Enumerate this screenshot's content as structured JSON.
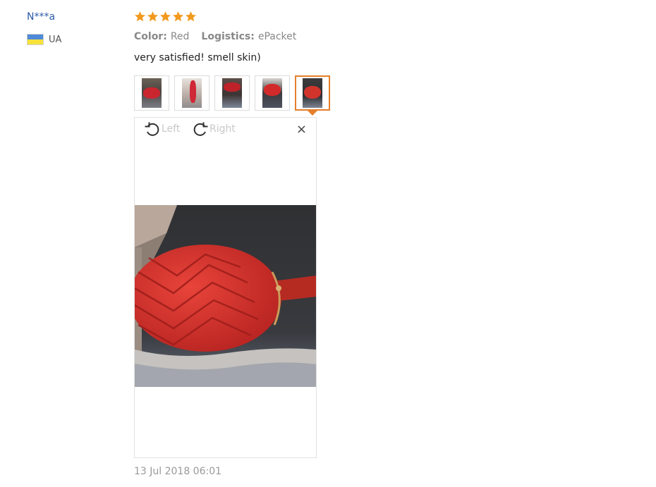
{
  "reviewer": {
    "name": "N***a",
    "country": "UA"
  },
  "review": {
    "rating": 5,
    "attributes": [
      {
        "label": "Color:",
        "value": "Red"
      },
      {
        "label": "Logistics:",
        "value": "ePacket"
      }
    ],
    "text": "very satisfied! smell skin)",
    "photo_count": 5,
    "selected_photo_index": 5,
    "date": "13 Jul 2018 06:01"
  },
  "viewer": {
    "rotate_left_label": "Left",
    "rotate_right_label": "Right",
    "close_label": "×"
  },
  "colors": {
    "star": "#f19a1f",
    "accent": "#e57f2b",
    "reviewer_name": "#2b5ba7"
  },
  "icons": [
    "star-icon",
    "flag-ua-icon",
    "rotate-left-icon",
    "rotate-right-icon",
    "close-icon"
  ]
}
